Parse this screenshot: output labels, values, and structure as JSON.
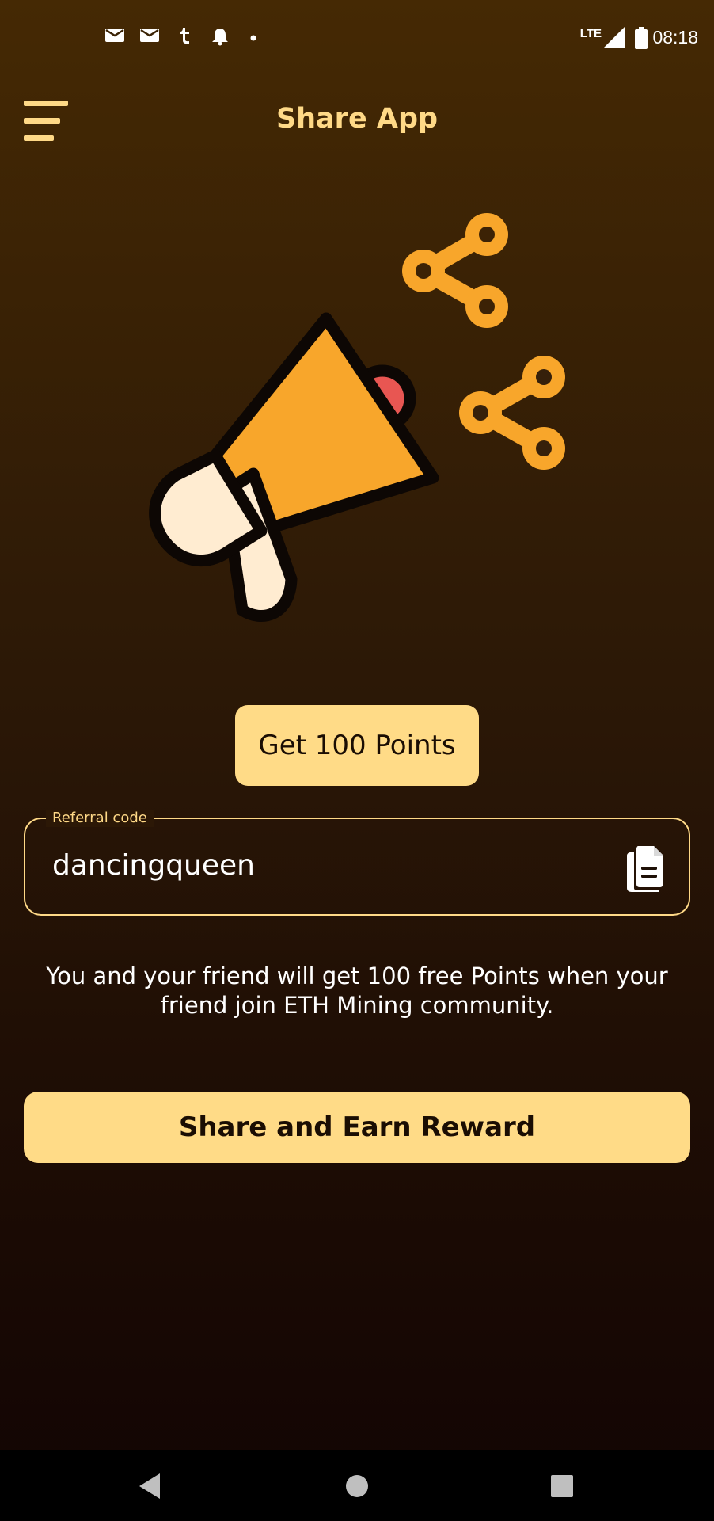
{
  "status_bar": {
    "time": "08:18",
    "network": "LTE",
    "notification_icons": [
      "mail-icon",
      "mail-icon",
      "tumblr-icon",
      "bell-icon",
      "dot-icon"
    ]
  },
  "header": {
    "title": "Share App",
    "menu_icon": "hamburger-menu-icon"
  },
  "hero": {
    "illustration": "megaphone-icon",
    "share_icons": [
      "share-icon",
      "share-icon"
    ]
  },
  "points_button": {
    "label": "Get 100 Points"
  },
  "referral": {
    "label": "Referral code",
    "value": "dancingqueen",
    "copy_icon": "copy-icon"
  },
  "info": {
    "text": "You and your friend will get 100 free Points when your friend join ETH Mining community."
  },
  "share_button": {
    "label": "Share and Earn Reward"
  },
  "nav_bar": {
    "buttons": [
      "back-icon",
      "home-icon",
      "recents-icon"
    ]
  },
  "colors": {
    "accent": "#ffd987",
    "button_bg": "#ffdb87",
    "megaphone_orange": "#f8a62b",
    "megaphone_cream": "#ffecd1",
    "megaphone_red": "#e85652",
    "background_top": "#452904",
    "background_bottom": "#120403"
  }
}
